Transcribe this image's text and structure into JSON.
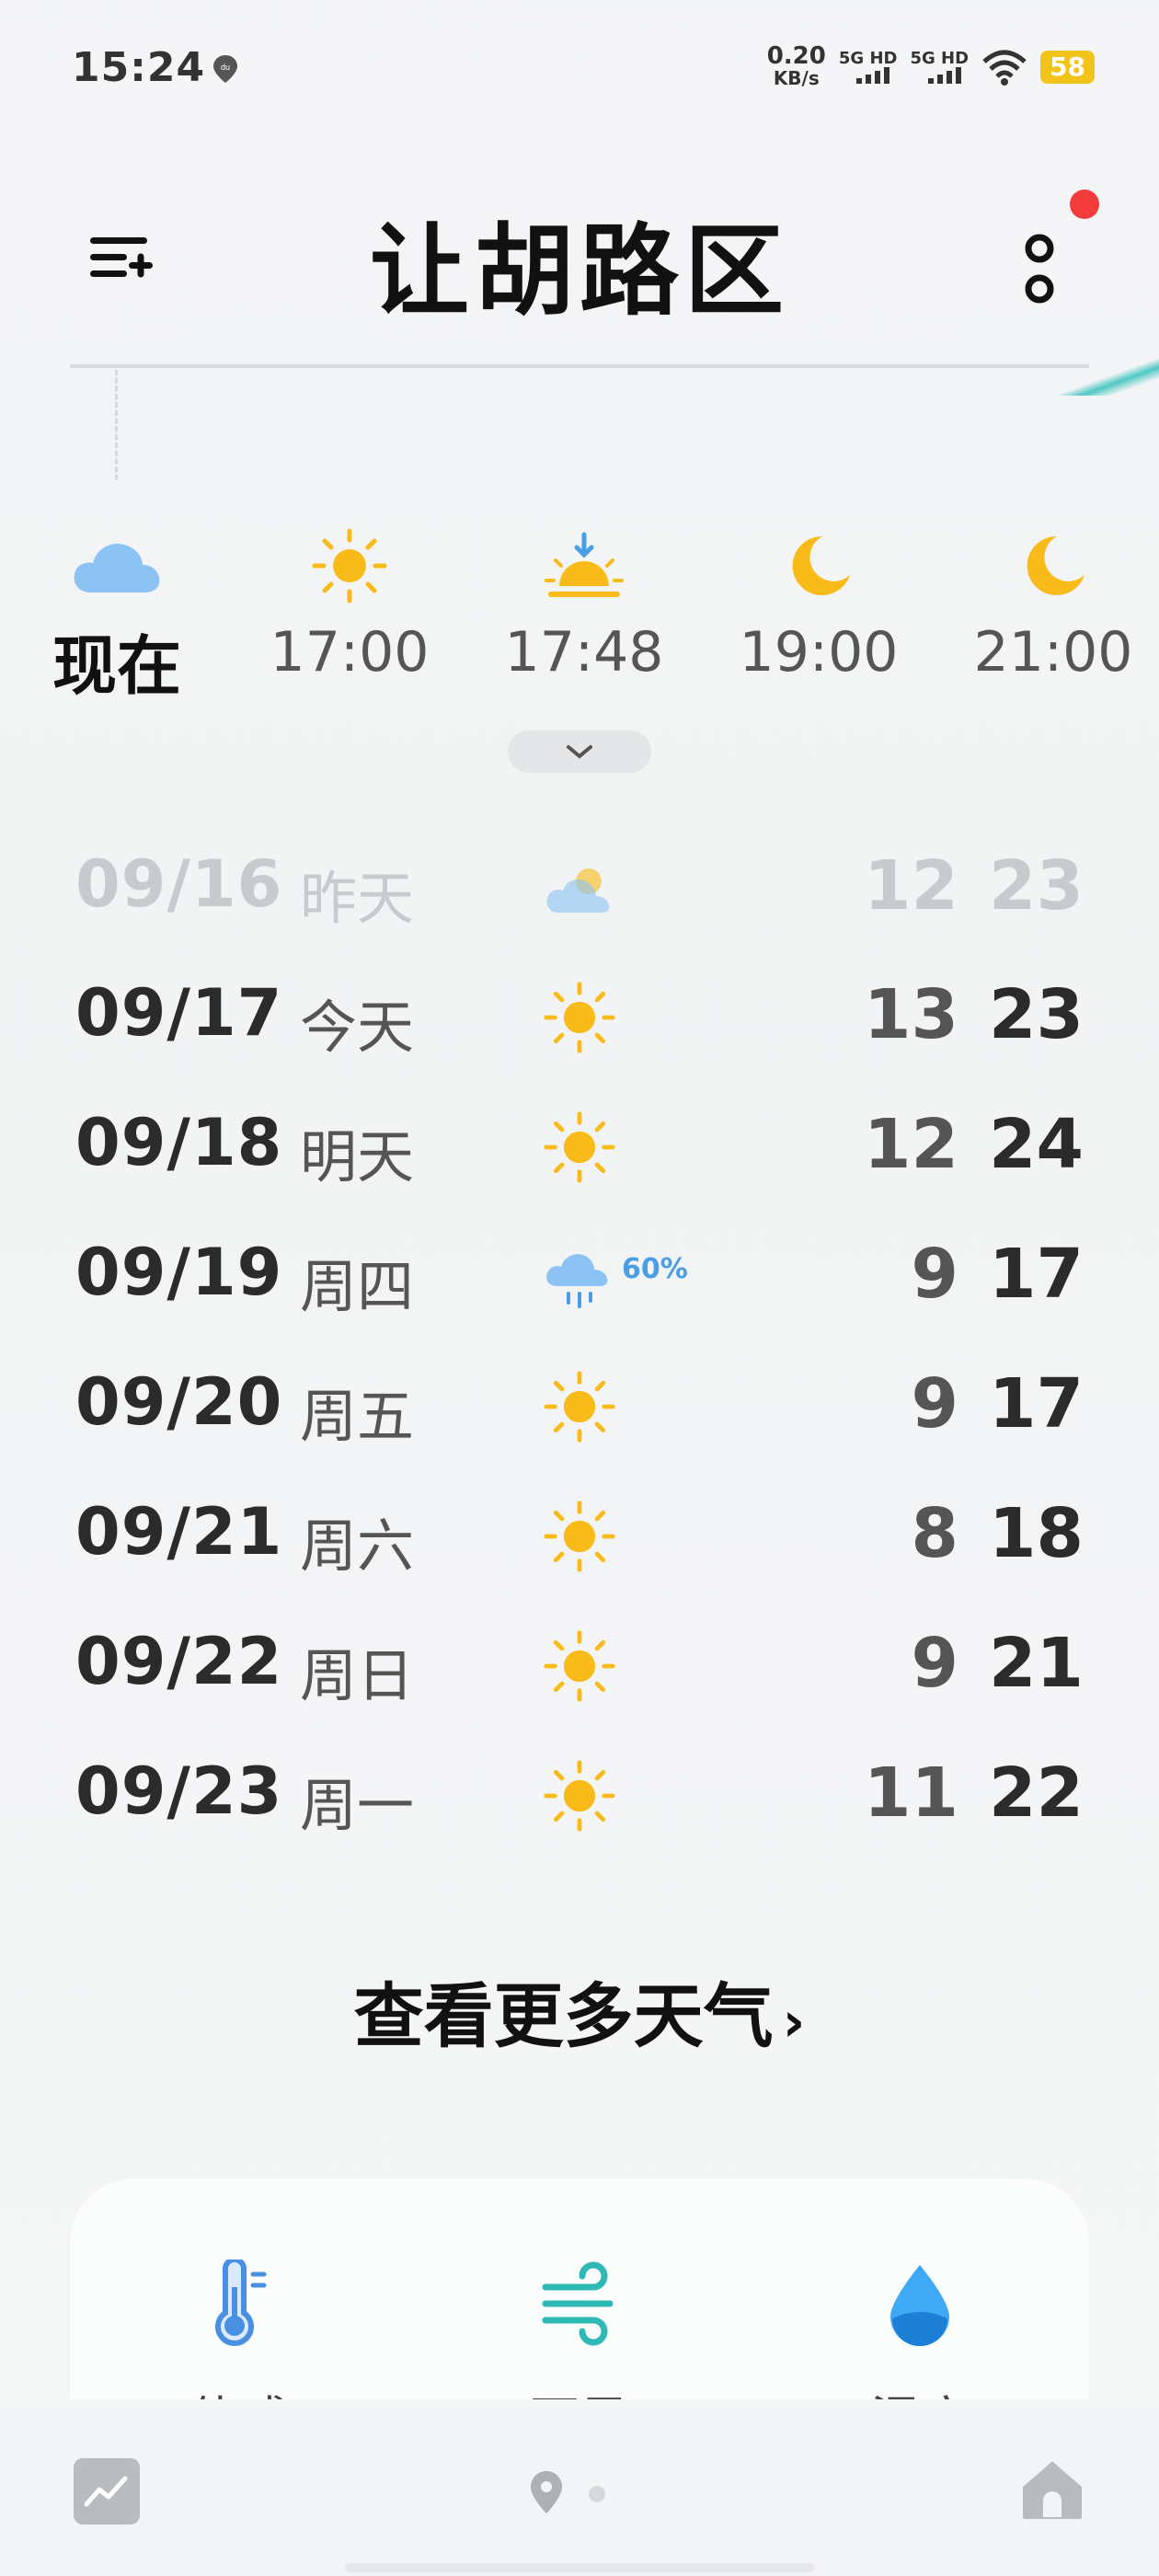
{
  "status_bar": {
    "time": "15:24",
    "net_speed": "0.20",
    "net_unit": "KB/s",
    "sim1": "5G HD",
    "sim2": "5G HD",
    "battery": "58"
  },
  "header": {
    "city": "让胡路区"
  },
  "hourly": [
    {
      "label": "现在",
      "icon": "cloud-icon"
    },
    {
      "label": "17:00",
      "icon": "sun-icon"
    },
    {
      "label": "17:48",
      "icon": "sunset-icon"
    },
    {
      "label": "19:00",
      "icon": "moon-icon"
    },
    {
      "label": "21:00",
      "icon": "moon-icon"
    }
  ],
  "daily": [
    {
      "date": "09/16",
      "day": "昨天",
      "icon": "partly-cloudy-icon",
      "precip": "",
      "low": "12",
      "high": "23"
    },
    {
      "date": "09/17",
      "day": "今天",
      "icon": "sun-icon",
      "precip": "",
      "low": "13",
      "high": "23"
    },
    {
      "date": "09/18",
      "day": "明天",
      "icon": "sun-icon",
      "precip": "",
      "low": "12",
      "high": "24"
    },
    {
      "date": "09/19",
      "day": "周四",
      "icon": "rain-icon",
      "precip": "60%",
      "low": "9",
      "high": "17"
    },
    {
      "date": "09/20",
      "day": "周五",
      "icon": "sun-icon",
      "precip": "",
      "low": "9",
      "high": "17"
    },
    {
      "date": "09/21",
      "day": "周六",
      "icon": "sun-icon",
      "precip": "",
      "low": "8",
      "high": "18"
    },
    {
      "date": "09/22",
      "day": "周日",
      "icon": "sun-icon",
      "precip": "",
      "low": "9",
      "high": "21"
    },
    {
      "date": "09/23",
      "day": "周一",
      "icon": "sun-icon",
      "precip": "",
      "low": "11",
      "high": "22"
    }
  ],
  "more_weather_label": "查看更多天气",
  "details": [
    {
      "label": "体感",
      "icon": "thermometer-icon"
    },
    {
      "label": "西风",
      "icon": "wind-icon"
    },
    {
      "label": "湿度",
      "icon": "humidity-icon"
    }
  ],
  "colors": {
    "sun": "#f8bb1a",
    "cloud": "#8cc3f4",
    "rain_text": "#4a9ee6",
    "accent_teal": "#3cc3bf",
    "alert": "#f23b3b"
  }
}
